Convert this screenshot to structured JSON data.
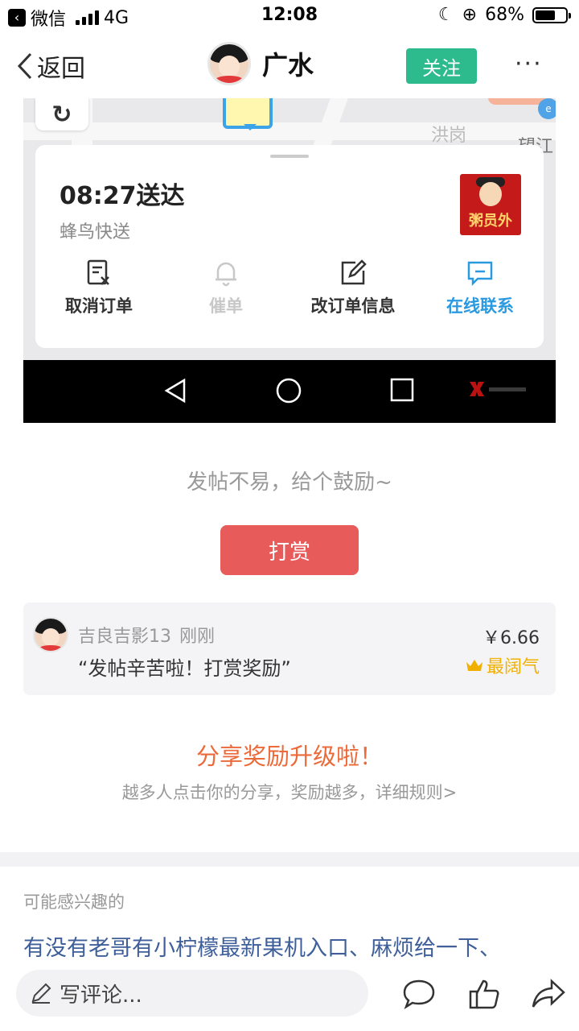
{
  "status_bar": {
    "app": "微信",
    "network": "4G",
    "time": "12:08",
    "battery": "68%",
    "battery_level": 0.68
  },
  "nav": {
    "back_label": "返回",
    "title": "广水",
    "follow_label": "关注",
    "more": "···"
  },
  "embedded_screenshot": {
    "map_labels": [
      "洪岗",
      "望江"
    ],
    "eta": "08:27送达",
    "courier": "蜂鸟快送",
    "shop_logo_text": "粥员外",
    "actions": [
      {
        "label": "取消订单",
        "state": "normal",
        "icon": "cancel-order-icon"
      },
      {
        "label": "催单",
        "state": "disabled",
        "icon": "bell-icon"
      },
      {
        "label": "改订单信息",
        "state": "normal",
        "icon": "edit-icon"
      },
      {
        "label": "在线联系",
        "state": "accent",
        "icon": "chat-icon"
      }
    ]
  },
  "reward": {
    "encourage": "发帖不易，给个鼓励~",
    "button": "打赏",
    "entry": {
      "user": "吉良吉影13",
      "time": "刚刚",
      "message": "“发帖辛苦啦！打赏奖励”",
      "amount": "￥6.66",
      "badge": "最阔气"
    }
  },
  "share": {
    "title": "分享奖励升级啦！",
    "subtitle": "越多人点击你的分享，奖励越多，详细规则>"
  },
  "related": {
    "title": "可能感兴趣的",
    "link": "有没有老哥有小柠檬最新果机入口、麻烦给一下、"
  },
  "bottom_bar": {
    "comment_placeholder": "写评论..."
  },
  "colors": {
    "follow": "#2dba8c",
    "reward": "#e85b5b",
    "share_title": "#ec6a3a",
    "link": "#3e5f9a",
    "accent_blue": "#2a9ae0",
    "badge_gold": "#f0b000"
  }
}
